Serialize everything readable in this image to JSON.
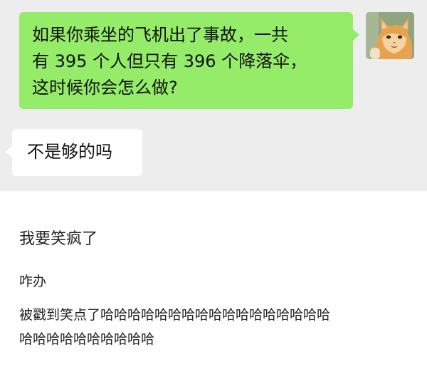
{
  "chat": {
    "outgoing_message": {
      "line1": "如果你乘坐的飞机出了事故，一共",
      "line2": "有 395 个人但只有 396 个降落伞，",
      "line3": "这时候你会怎么做?"
    },
    "incoming_message": "不是够的吗",
    "avatar_icon": "cat-photo-avatar"
  },
  "comments": {
    "first": "我要笑疯了",
    "second": "咋办",
    "third_line1": "被戳到笑点了哈哈哈哈哈哈哈哈哈哈哈哈哈哈哈哈哈",
    "third_line2": "哈哈哈哈哈哈哈哈哈哈"
  },
  "colors": {
    "chat_background": "#ededed",
    "outgoing_bubble": "#95ec69",
    "incoming_bubble": "#ffffff"
  }
}
